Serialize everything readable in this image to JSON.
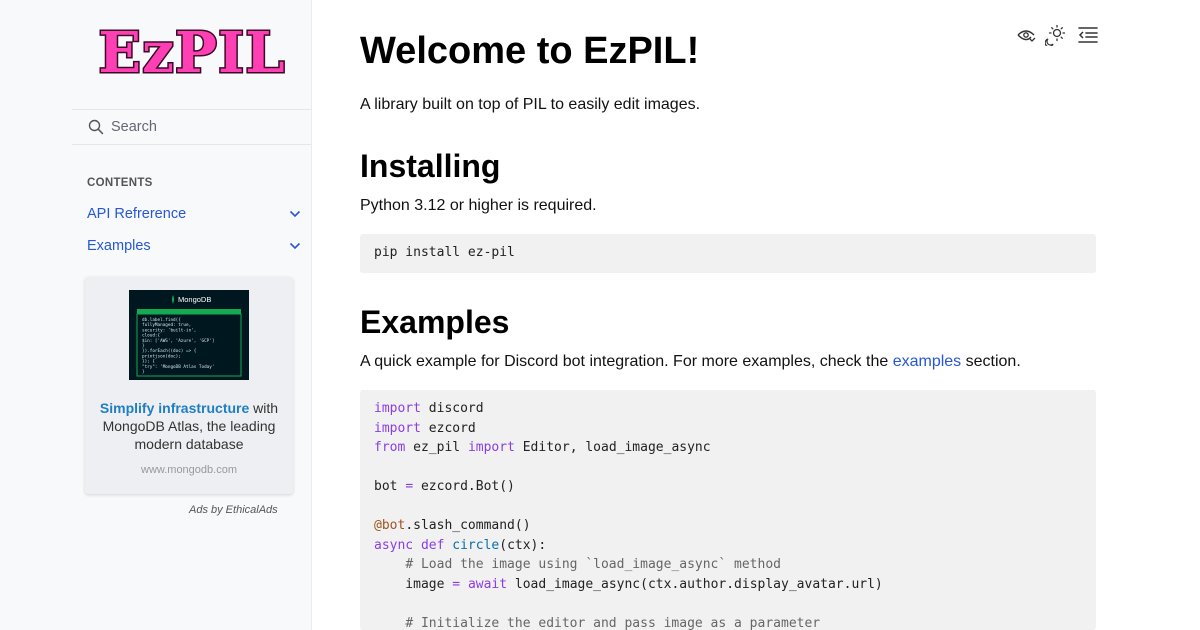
{
  "sidebar": {
    "logo_text": "EzPIL",
    "search": {
      "placeholder": "Search"
    },
    "caption": "CONTENTS",
    "items": [
      {
        "label": "API Refrerence"
      },
      {
        "label": "Examples"
      }
    ],
    "ad": {
      "image_brand": "MongoDB",
      "image_code": [
        "db.label.find({",
        "  fullyManaged: true,",
        "  security: 'built-in',",
        "  cloud:{",
        "    $in: ['AWS', 'Azure', 'GCP']",
        "  }",
        "}).forEach((doc) => {",
        "  printjson(doc);",
        "});  {",
        "  \"try\": 'MongoDB Atlas Today'",
        "}"
      ],
      "headline": "Simplify infrastructure",
      "body": "with MongoDB Atlas, the leading modern database",
      "domain": "www.mongodb.com",
      "by": "Ads by EthicalAds"
    }
  },
  "toolbar": {
    "icons": [
      "view-source-icon",
      "theme-toggle-icon",
      "toc-toggle-icon"
    ]
  },
  "main": {
    "title": "Welcome to EzPIL!",
    "intro": "A library built on top of PIL to easily edit images.",
    "installing": {
      "heading": "Installing",
      "text": "Python 3.12 or higher is required.",
      "command": "pip install ez-pil"
    },
    "examples": {
      "heading": "Examples",
      "text_before": "A quick example for Discord bot integration. For more examples, check the ",
      "link": "examples",
      "text_after": " section."
    },
    "code_lines": [
      "import discord",
      "import ezcord",
      "from ez_pil import Editor, load_image_async",
      "",
      "bot = ezcord.Bot()",
      "",
      "@bot.slash_command()",
      "async def circle(ctx):",
      "    # Load the image using `load_image_async` method",
      "    image = await load_image_async(ctx.author.display_avatar.url)",
      "",
      "    # Initialize the editor and pass image as a parameter"
    ]
  },
  "colors": {
    "logo_fill": "#ff3fb4",
    "logo_stroke": "#3a0a26",
    "link": "#2757d6",
    "sidebar_bg": "#f8f9fb",
    "code_bg": "#f1f1f1",
    "ad_bg": "#00171f",
    "ad_accent": "#13aa52"
  }
}
